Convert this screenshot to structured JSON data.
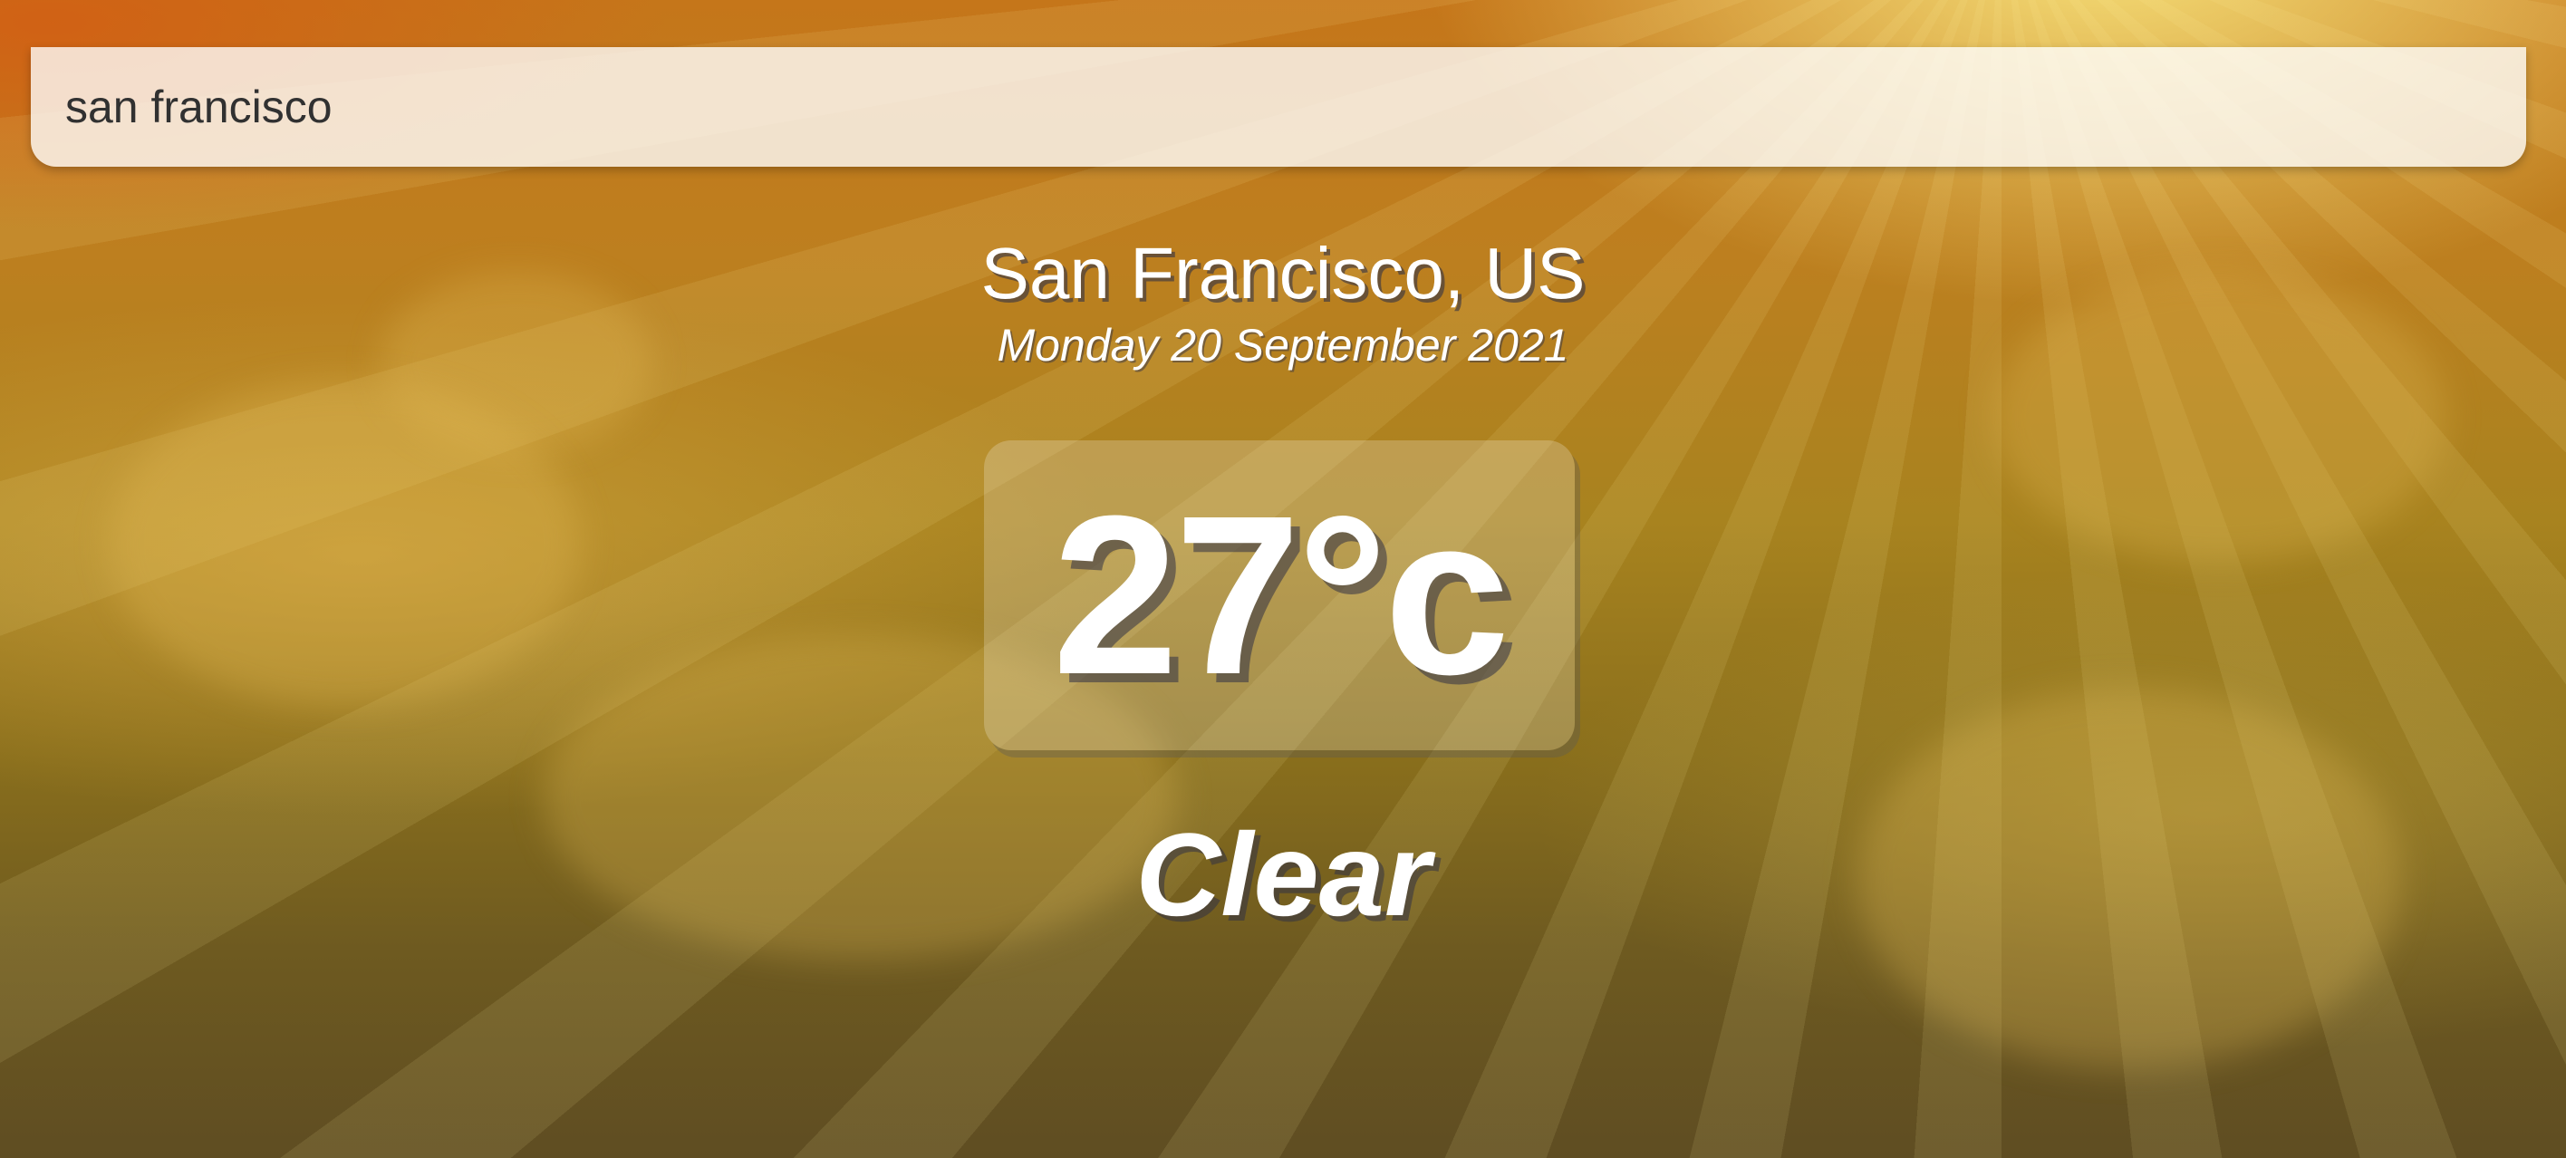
{
  "search": {
    "value": "san francisco",
    "placeholder": ""
  },
  "location": {
    "name": "San Francisco, US",
    "date": "Monday 20 September 2021"
  },
  "weather": {
    "temperature": "27°c",
    "condition": "Clear"
  },
  "colors": {
    "background_top": "#c5761a",
    "background_bottom": "#5f4d22",
    "text": "#ffffff",
    "search_text": "#313131"
  }
}
